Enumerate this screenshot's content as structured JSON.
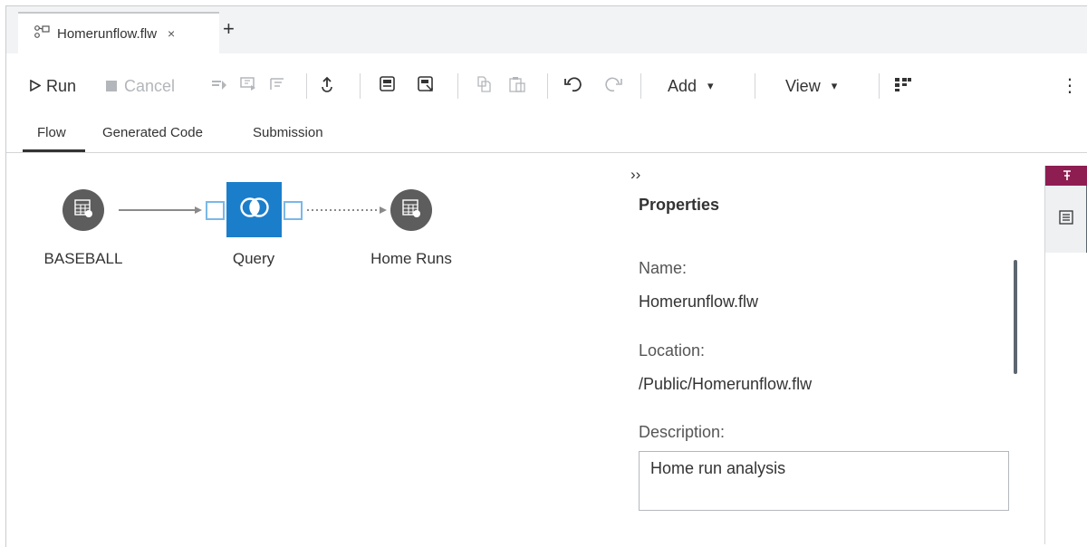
{
  "tab": {
    "title": "Homerunflow.flw",
    "close_glyph": "×",
    "new_glyph": "+",
    "icon": "flow-icon"
  },
  "toolbar": {
    "run_label": "Run",
    "cancel_label": "Cancel",
    "add_label": "Add",
    "view_label": "View",
    "dropdown_glyph": "▾",
    "more_glyph": "⋮"
  },
  "subtabs": [
    "Flow",
    "Generated Code",
    "Submission"
  ],
  "flow": {
    "nodes": [
      {
        "label": "BASEBALL",
        "icon": "table-icon"
      },
      {
        "label": "Query",
        "icon": "query-join-icon"
      },
      {
        "label": "Home Runs",
        "icon": "table-icon"
      }
    ]
  },
  "properties": {
    "collapse_glyph": "››",
    "title": "Properties",
    "name_label": "Name:",
    "name_value": "Homerunflow.flw",
    "location_label": "Location:",
    "location_value": "/Public/Homerunflow.flw",
    "description_label": "Description:",
    "description_value": "Home run analysis"
  },
  "colors": {
    "accent": "#1b7ecb",
    "pin": "#8e1d52",
    "node": "#5d5d5d"
  }
}
